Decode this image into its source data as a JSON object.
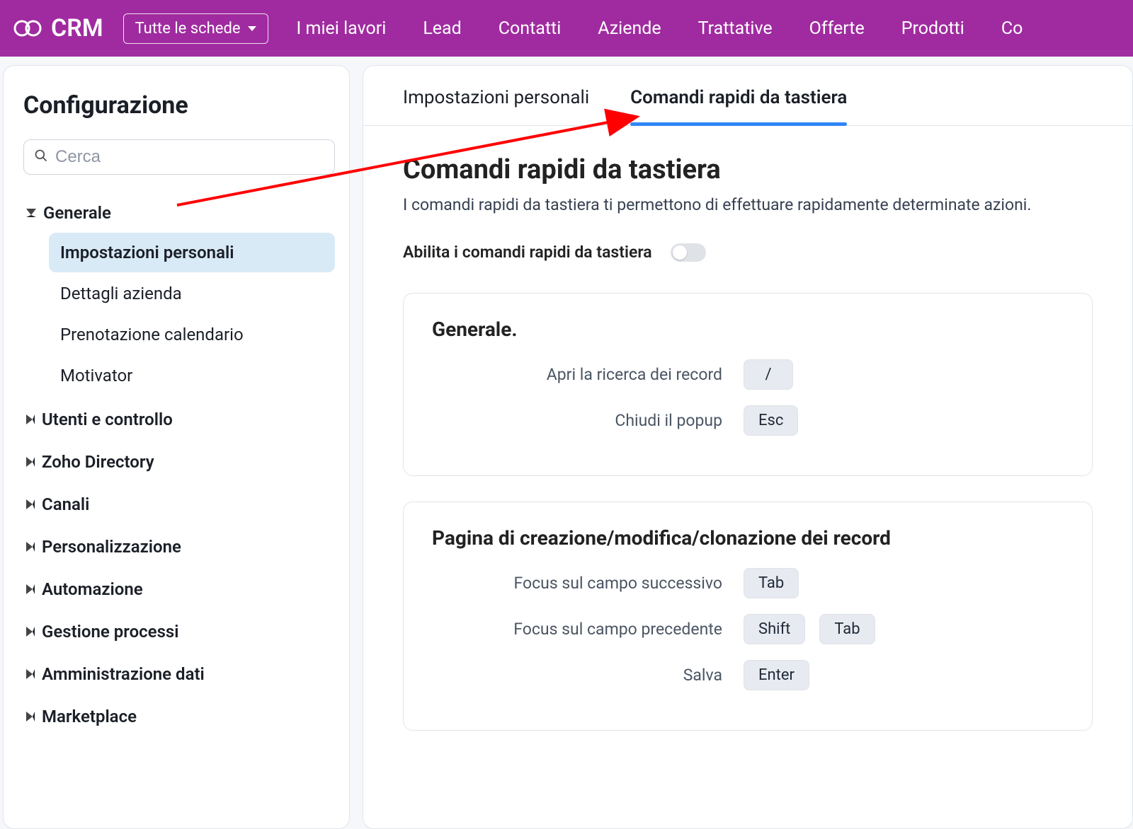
{
  "topbar": {
    "brand": "CRM",
    "all_tabs_label": "Tutte le schede",
    "nav": [
      "I miei lavori",
      "Lead",
      "Contatti",
      "Aziende",
      "Trattative",
      "Offerte",
      "Prodotti",
      "Co"
    ]
  },
  "sidebar": {
    "title": "Configurazione",
    "search_placeholder": "Cerca",
    "groups": [
      {
        "label": "Generale",
        "expanded": true,
        "items": [
          "Impostazioni personali",
          "Dettagli azienda",
          "Prenotazione calendario",
          "Motivator"
        ],
        "active_index": 0
      },
      {
        "label": "Utenti e controllo",
        "expanded": false
      },
      {
        "label": "Zoho Directory",
        "expanded": false
      },
      {
        "label": "Canali",
        "expanded": false
      },
      {
        "label": "Personalizzazione",
        "expanded": false
      },
      {
        "label": "Automazione",
        "expanded": false
      },
      {
        "label": "Gestione processi",
        "expanded": false
      },
      {
        "label": "Amministrazione dati",
        "expanded": false
      },
      {
        "label": "Marketplace",
        "expanded": false
      }
    ]
  },
  "content": {
    "tabs": [
      "Impostazioni personali",
      "Comandi rapidi da tastiera"
    ],
    "active_tab": 1,
    "heading": "Comandi rapidi da tastiera",
    "description": "I comandi rapidi da tastiera ti permettono di effettuare rapidamente determinate azioni.",
    "toggle_label": "Abilita i comandi rapidi da tastiera",
    "toggle_enabled": false,
    "sections": [
      {
        "title": "Generale.",
        "rows": [
          {
            "label": "Apri la ricerca dei record",
            "keys": [
              "/"
            ]
          },
          {
            "label": "Chiudi il popup",
            "keys": [
              "Esc"
            ]
          }
        ]
      },
      {
        "title": "Pagina di creazione/modifica/clonazione dei record",
        "rows": [
          {
            "label": "Focus sul campo successivo",
            "keys": [
              "Tab"
            ]
          },
          {
            "label": "Focus sul campo precedente",
            "keys": [
              "Shift",
              "Tab"
            ]
          },
          {
            "label": "Salva",
            "keys": [
              "Enter"
            ]
          }
        ]
      }
    ]
  },
  "colors": {
    "topbar": "#a12da3",
    "tab_underline": "#2f86f6",
    "sidebar_active_bg": "#d9eaf7",
    "arrow": "#ff0000"
  }
}
